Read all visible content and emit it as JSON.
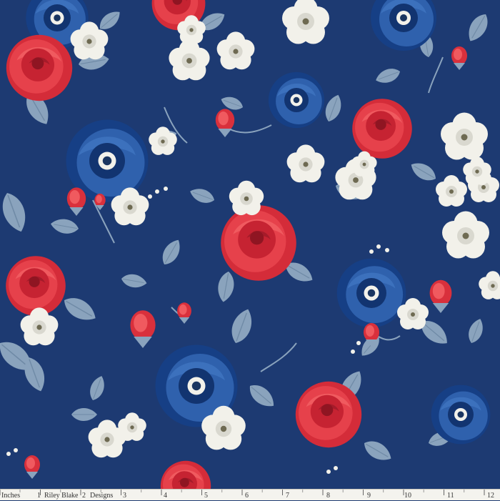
{
  "image": {
    "background_color": "#1d3a72",
    "motif": "floral print with red roses, blue roses, white blossoms and grey-blue leaves"
  },
  "ruler": {
    "unit_label": "Inches",
    "brand_left": "Riley Blake",
    "brand_right": "Designs",
    "numbers": [
      "1",
      "2",
      "3",
      "4",
      "5",
      "6",
      "7",
      "8",
      "9",
      "10",
      "11",
      "12"
    ]
  },
  "colors": {
    "navy": "#1d3a72",
    "leaf": "#8aa3bd",
    "red_rose": "#e0353f",
    "blue_rose": "#2a5aa3",
    "white_flower": "#f2f1ea"
  }
}
